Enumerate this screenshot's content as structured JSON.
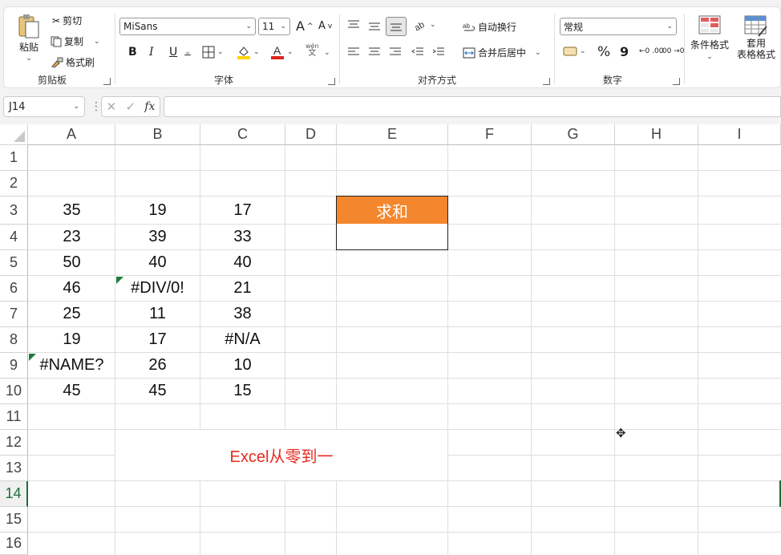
{
  "ribbon": {
    "clipboard": {
      "paste": "粘贴",
      "cut": "剪切",
      "copy": "复制",
      "painter": "格式刷",
      "label": "剪贴板"
    },
    "font": {
      "name": "MiSans",
      "size": "11",
      "grow": "A",
      "shrink": "A",
      "bold": "B",
      "italic": "I",
      "underline": "U",
      "wen": "wén",
      "wen_char": "文",
      "label": "字体"
    },
    "align": {
      "wrap": "自动换行",
      "merge": "合并后居中",
      "label": "对齐方式"
    },
    "number": {
      "format": "常规",
      "percent": "%",
      "comma": "9",
      "inc": "←0 .00",
      "dec": ".00 →0",
      "label": "数字"
    },
    "styles": {
      "cond": "条件格式",
      "table_1": "套用",
      "table_2": "表格格式"
    }
  },
  "formula_bar": {
    "name_box": "J14",
    "fx": "fx",
    "value": ""
  },
  "columns": [
    "A",
    "B",
    "C",
    "D",
    "E",
    "F",
    "G",
    "H",
    "I"
  ],
  "rows": [
    "1",
    "2",
    "3",
    "4",
    "5",
    "6",
    "7",
    "8",
    "9",
    "10",
    "11",
    "12",
    "13",
    "14",
    "15",
    "16"
  ],
  "data": {
    "A": [
      "35",
      "23",
      "50",
      "46",
      "25",
      "19",
      "#NAME?",
      "45"
    ],
    "B": [
      "19",
      "39",
      "40",
      "#DIV/0!",
      "11",
      "17",
      "26",
      "45"
    ],
    "C": [
      "17",
      "33",
      "40",
      "21",
      "38",
      "#N/A",
      "10",
      "15"
    ]
  },
  "sum_header": "求和",
  "sum_value": "",
  "watermark": "Excel从零到一",
  "colors": {
    "sum_bg": "#f4862d",
    "watermark": "#e52b22",
    "accent": "#1e6e3a",
    "font_red": "#e0241b",
    "highlight": "#ffd500"
  }
}
